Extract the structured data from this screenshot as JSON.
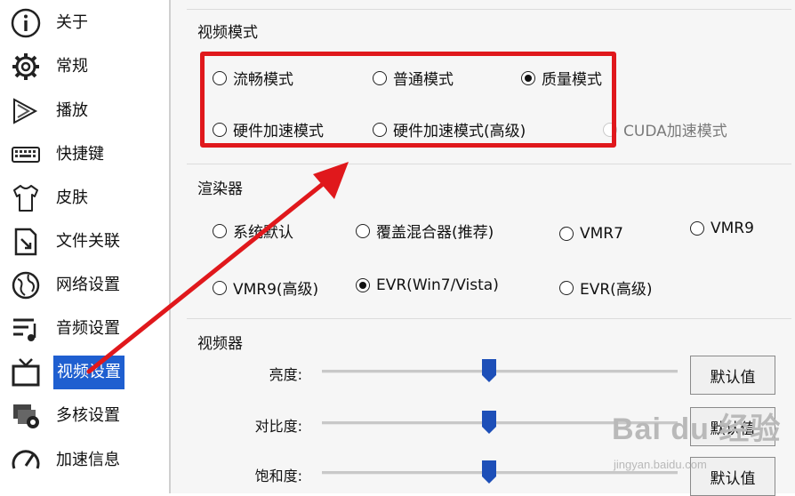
{
  "sidebar": {
    "items": [
      {
        "label": "关于",
        "icon": "info-icon"
      },
      {
        "label": "常规",
        "icon": "gear-icon"
      },
      {
        "label": "播放",
        "icon": "play-icon"
      },
      {
        "label": "快捷键",
        "icon": "keyboard-icon"
      },
      {
        "label": "皮肤",
        "icon": "shirt-icon"
      },
      {
        "label": "文件关联",
        "icon": "file-link-icon"
      },
      {
        "label": "网络设置",
        "icon": "globe-icon"
      },
      {
        "label": "音频设置",
        "icon": "audio-icon"
      },
      {
        "label": "视频设置",
        "icon": "tv-icon"
      },
      {
        "label": "多核设置",
        "icon": "multicore-icon"
      },
      {
        "label": "加速信息",
        "icon": "speedometer-icon"
      }
    ],
    "active_index": 8,
    "active_color": "#1f5fd0"
  },
  "video_mode": {
    "title": "视频模式",
    "options": [
      {
        "label": "流畅模式",
        "selected": false,
        "disabled": false
      },
      {
        "label": "普通模式",
        "selected": false,
        "disabled": false
      },
      {
        "label": "质量模式",
        "selected": true,
        "disabled": false
      },
      {
        "label": "硬件加速模式",
        "selected": false,
        "disabled": false
      },
      {
        "label": "硬件加速模式(高级)",
        "selected": false,
        "disabled": false
      },
      {
        "label": "CUDA加速模式",
        "selected": false,
        "disabled": true
      }
    ]
  },
  "renderer": {
    "title": "渲染器",
    "options": [
      {
        "label": "系统默认",
        "selected": false
      },
      {
        "label": "覆盖混合器(推荐)",
        "selected": false
      },
      {
        "label": "VMR7",
        "selected": false
      },
      {
        "label": "VMR9",
        "selected": false
      },
      {
        "label": "VMR9(高级)",
        "selected": false
      },
      {
        "label": "EVR(Win7/Vista)",
        "selected": true
      },
      {
        "label": "EVR(高级)",
        "selected": false
      }
    ]
  },
  "video_adjust": {
    "title": "视频器",
    "sliders": [
      {
        "label": "亮度:",
        "value": 0.47,
        "button": "默认值"
      },
      {
        "label": "对比度:",
        "value": 0.47,
        "button": "默认值"
      },
      {
        "label": "饱和度:",
        "value": 0.47,
        "button": "默认值"
      }
    ]
  },
  "annotation": {
    "highlight_color": "#e0181c"
  },
  "watermark": {
    "text": "Bai du 经验",
    "sub": "jingyan.baidu.com"
  },
  "colors": {
    "thumb": "#1d4fb8"
  }
}
